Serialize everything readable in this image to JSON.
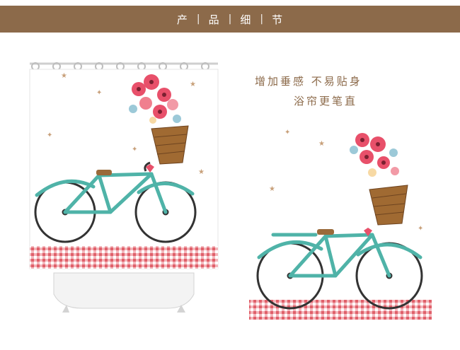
{
  "header": {
    "items": [
      "产",
      "品",
      "细",
      "节"
    ]
  },
  "tagline": {
    "line1": "增加垂感  不易贴身",
    "line2": "浴帘更笔直"
  },
  "colors": {
    "header_bg": "#8c6a4a",
    "accent_text": "#8c6a4a",
    "bike_frame": "#4fb3a8",
    "gingham": "#e0606a",
    "flower": "#e8506a"
  },
  "images": {
    "left": "shower-curtain-bicycle-illustration",
    "right": "bicycle-flower-basket-closeup"
  }
}
